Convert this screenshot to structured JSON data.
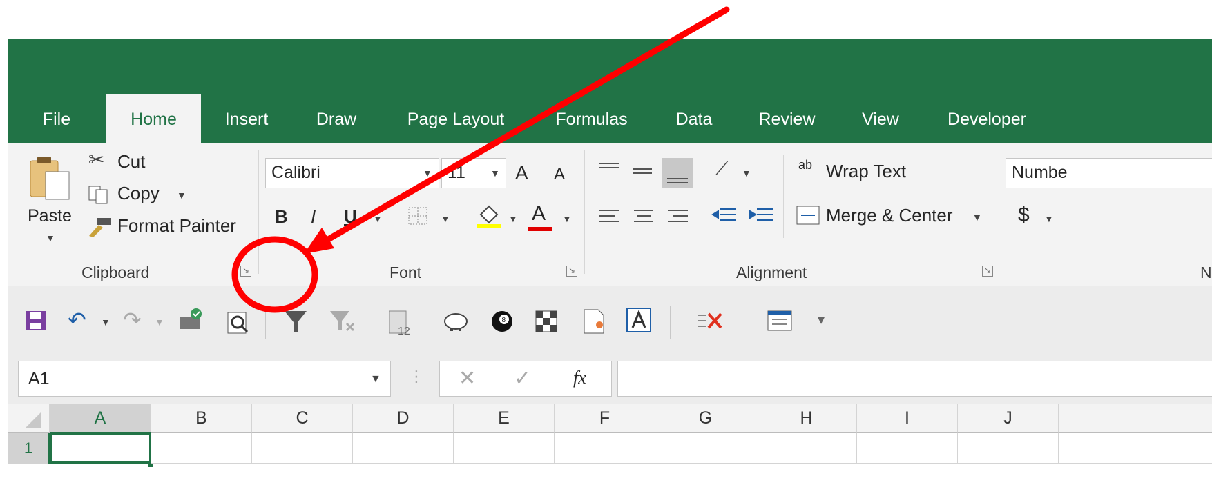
{
  "tabs": [
    "File",
    "Home",
    "Insert",
    "Draw",
    "Page Layout",
    "Formulas",
    "Data",
    "Review",
    "View",
    "Developer"
  ],
  "active_tab": "Home",
  "clipboard": {
    "paste_label": "Paste",
    "cut_label": "Cut",
    "copy_label": "Copy",
    "format_painter_label": "Format Painter",
    "group_label": "Clipboard"
  },
  "font": {
    "font_name": "Calibri",
    "font_size": "11",
    "bold": "B",
    "italic": "I",
    "underline": "U",
    "font_color_glyph": "A",
    "grow_glyph": "A",
    "shrink_glyph": "A",
    "group_label": "Font",
    "highlight_color": "#ffff00",
    "font_color": "#e00000"
  },
  "alignment": {
    "wrap_text_label": "Wrap Text",
    "merge_center_label": "Merge & Center",
    "wrap_icon_text": "ab",
    "group_label": "Alignment"
  },
  "number": {
    "format_value": "Numbe",
    "currency_glyph": "$",
    "group_label_partial": "N"
  },
  "formula_bar": {
    "name_box": "A1",
    "fx_label": "fx",
    "formula_value": ""
  },
  "columns": [
    "A",
    "B",
    "C",
    "D",
    "E",
    "F",
    "G",
    "H",
    "I",
    "J"
  ],
  "rows": [
    "1"
  ],
  "selected_cell": "A1",
  "colors": {
    "brand_green": "#217346",
    "annotation_red": "#ff0000"
  },
  "qat_icons": [
    "save-icon",
    "undo-icon",
    "redo-icon",
    "spelling-check-icon",
    "print-preview-icon",
    "filter-icon",
    "clear-filter-icon",
    "clipboard-count-icon",
    "piggy-bank-icon",
    "eight-ball-icon",
    "checkerboard-icon",
    "document-ribbon-icon",
    "text-box-icon",
    "delete-columns-icon",
    "form-icon",
    "customize-qat-icon"
  ],
  "qat": {
    "clipboard_count": "12",
    "eight_ball_label": "8"
  }
}
